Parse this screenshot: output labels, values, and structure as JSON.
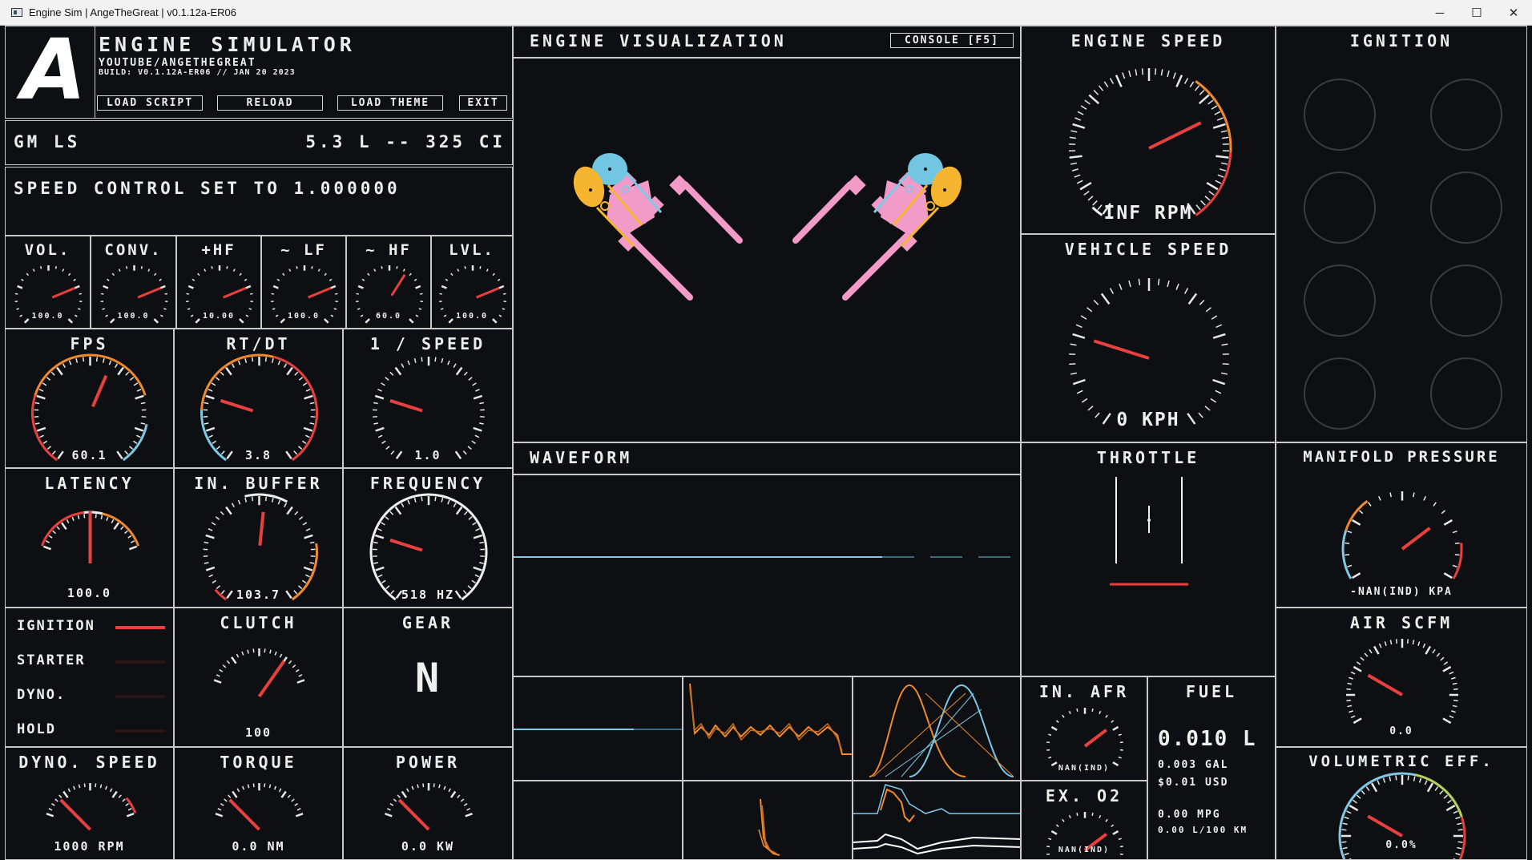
{
  "window": {
    "title": "Engine Sim | AngeTheGreat | v0.1.12a-ER06",
    "controls": [
      "─",
      "☐",
      "✕"
    ]
  },
  "header": {
    "logo": "A",
    "app_name": "ENGINE SIMULATOR",
    "channel": "YOUTUBE/ANGETHEGREAT",
    "build": "BUILD: V0.1.12A-ER06 // JAN 20 2023",
    "buttons": [
      "LOAD SCRIPT",
      "RELOAD",
      "LOAD THEME",
      "EXIT"
    ]
  },
  "engine": {
    "name": "GM LS",
    "displacement": "5.3 L -- 325 CI"
  },
  "status": {
    "message": "SPEED CONTROL SET TO 1.000000"
  },
  "audio_gauges": [
    {
      "title": "VOL.",
      "value": "100.0",
      "level": 0.75
    },
    {
      "title": "CONV.",
      "value": "100.0",
      "level": 0.75
    },
    {
      "title": "+HF",
      "value": "10.00",
      "level": 0.75
    },
    {
      "title": "~ LF",
      "value": "100.0",
      "level": 0.75
    },
    {
      "title": "~ HF",
      "value": "60.0",
      "level": 0.62
    },
    {
      "title": "LVL.",
      "value": "100.0",
      "level": 0.75
    }
  ],
  "perf_gauges": [
    {
      "title": "FPS",
      "value": "60.1",
      "level": 0.58
    },
    {
      "title": "RT/DT",
      "value": "3.8",
      "level": 0.25
    },
    {
      "title": "1 / SPEED",
      "value": "1.0",
      "level": 0.25
    },
    {
      "title": "LATENCY",
      "value": "100.0",
      "level": 0.5
    },
    {
      "title": "IN. BUFFER",
      "value": "103.7",
      "level": 0.52
    },
    {
      "title": "FREQUENCY",
      "value": "518 HZ",
      "level": 0.25
    }
  ],
  "toggles": {
    "items": [
      {
        "label": "IGNITION",
        "on": true
      },
      {
        "label": "STARTER",
        "on": false
      },
      {
        "label": "DYNO.",
        "on": false
      },
      {
        "label": "HOLD",
        "on": false
      }
    ]
  },
  "clutch": {
    "title": "CLUTCH",
    "value": "100",
    "level": 0.75
  },
  "gear": {
    "title": "GEAR",
    "value": "N"
  },
  "bottom_gauges": [
    {
      "title": "DYNO. SPEED",
      "value": "1000 RPM",
      "level": 0.18
    },
    {
      "title": "TORQUE",
      "value": "0.0 NM",
      "level": 0.18
    },
    {
      "title": "POWER",
      "value": "0.0 KW",
      "level": 0.18
    }
  ],
  "visualization": {
    "title": "ENGINE VISUALIZATION",
    "console_button": "CONSOLE [F5]"
  },
  "waveform": {
    "title": "WAVEFORM"
  },
  "engine_speed": {
    "title": "ENGINE SPEED",
    "value": "INF RPM",
    "level": 0.72
  },
  "vehicle_speed": {
    "title": "VEHICLE SPEED",
    "value": "0 KPH",
    "level": 0.25
  },
  "ignition": {
    "title": "IGNITION",
    "cylinders": 8
  },
  "throttle": {
    "title": "THROTTLE"
  },
  "manifold_pressure": {
    "title": "MANIFOLD PRESSURE",
    "value": "-NAN(IND) KPA",
    "level": 0.72
  },
  "air_scfm": {
    "title": "AIR SCFM",
    "value": "0.0",
    "level": 0.25
  },
  "in_afr": {
    "title": "IN. AFR",
    "value": "NAN(IND)",
    "level": 0.72
  },
  "ex_o2": {
    "title": "EX. O2",
    "value": "NAN(IND)",
    "level": 0.72
  },
  "fuel": {
    "title": "FUEL",
    "liters": "0.010 L",
    "gallons": "0.003 GAL",
    "cost": "$0.01 USD",
    "mpg": "0.00 MPG",
    "l_per_100km": "0.00 L/100 KM"
  },
  "volumetric_eff": {
    "title": "VOLUMETRIC EFF.",
    "value": "0.0%",
    "level": 0.25
  },
  "colors": {
    "accent_red": "#e8403e",
    "accent_orange": "#f08a2c",
    "accent_blue": "#7fc8e6",
    "cam_blue": "#72c6e2",
    "cam_yellow": "#f6b530",
    "rod_pink": "#f29ac8",
    "background": "#0e0f12",
    "border": "#c9c9c9"
  }
}
